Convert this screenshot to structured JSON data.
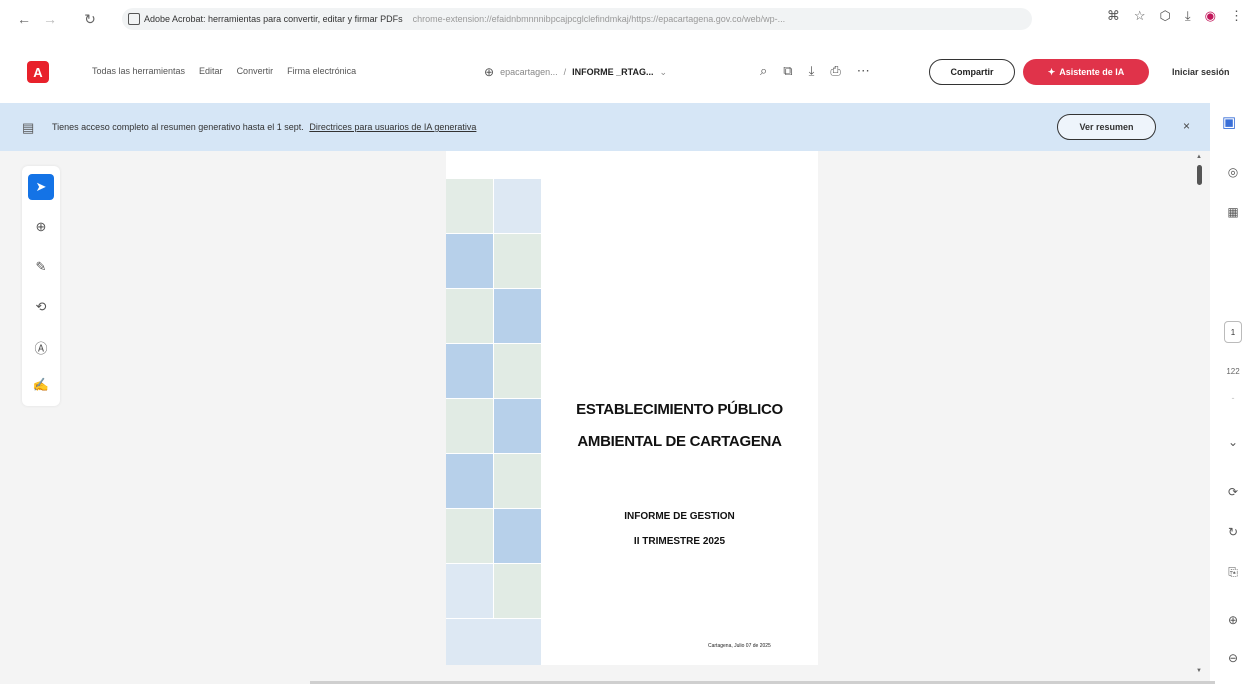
{
  "browser": {
    "tab_title": "Adobe Acrobat: herramientas para convertir, editar y firmar PDFs",
    "url": "chrome-extension://efaidnbmnnnibpcajpcglclefindmkaj/https://epacartagena.gov.co/web/wp-..."
  },
  "toolbar": {
    "menu": [
      "Todas las herramientas",
      "Editar",
      "Convertir",
      "Firma electrónica"
    ],
    "doc_site": "epacartagen...",
    "doc_name": "INFORME _RTAG...",
    "share_label": "Compartir",
    "ai_label": "Asistente de IA",
    "signin_label": "Iniciar sesión"
  },
  "banner": {
    "text": "Tienes acceso completo al resumen generativo hasta el 1 sept.",
    "link": "Directrices para usuarios de IA generativa",
    "button": "Ver resumen"
  },
  "document": {
    "title_line1": "ESTABLECIMIENTO PÚBLICO",
    "title_line2": "AMBIENTAL DE CARTAGENA",
    "subtitle_line1": "INFORME  DE GESTION",
    "subtitle_line2": "II TRIMESTRE 2025",
    "date": "Cartagena, Julio 07 de 2025"
  },
  "pagination": {
    "current": "1",
    "total": "122"
  },
  "colors": {
    "accent": "#1473e6",
    "acrobat_red": "#e8212b",
    "ai_button": "#e0334a",
    "banner_bg": "#d6e6f6",
    "tile_blue": "#b7d0ea",
    "tile_green": "#e1ebe4"
  }
}
